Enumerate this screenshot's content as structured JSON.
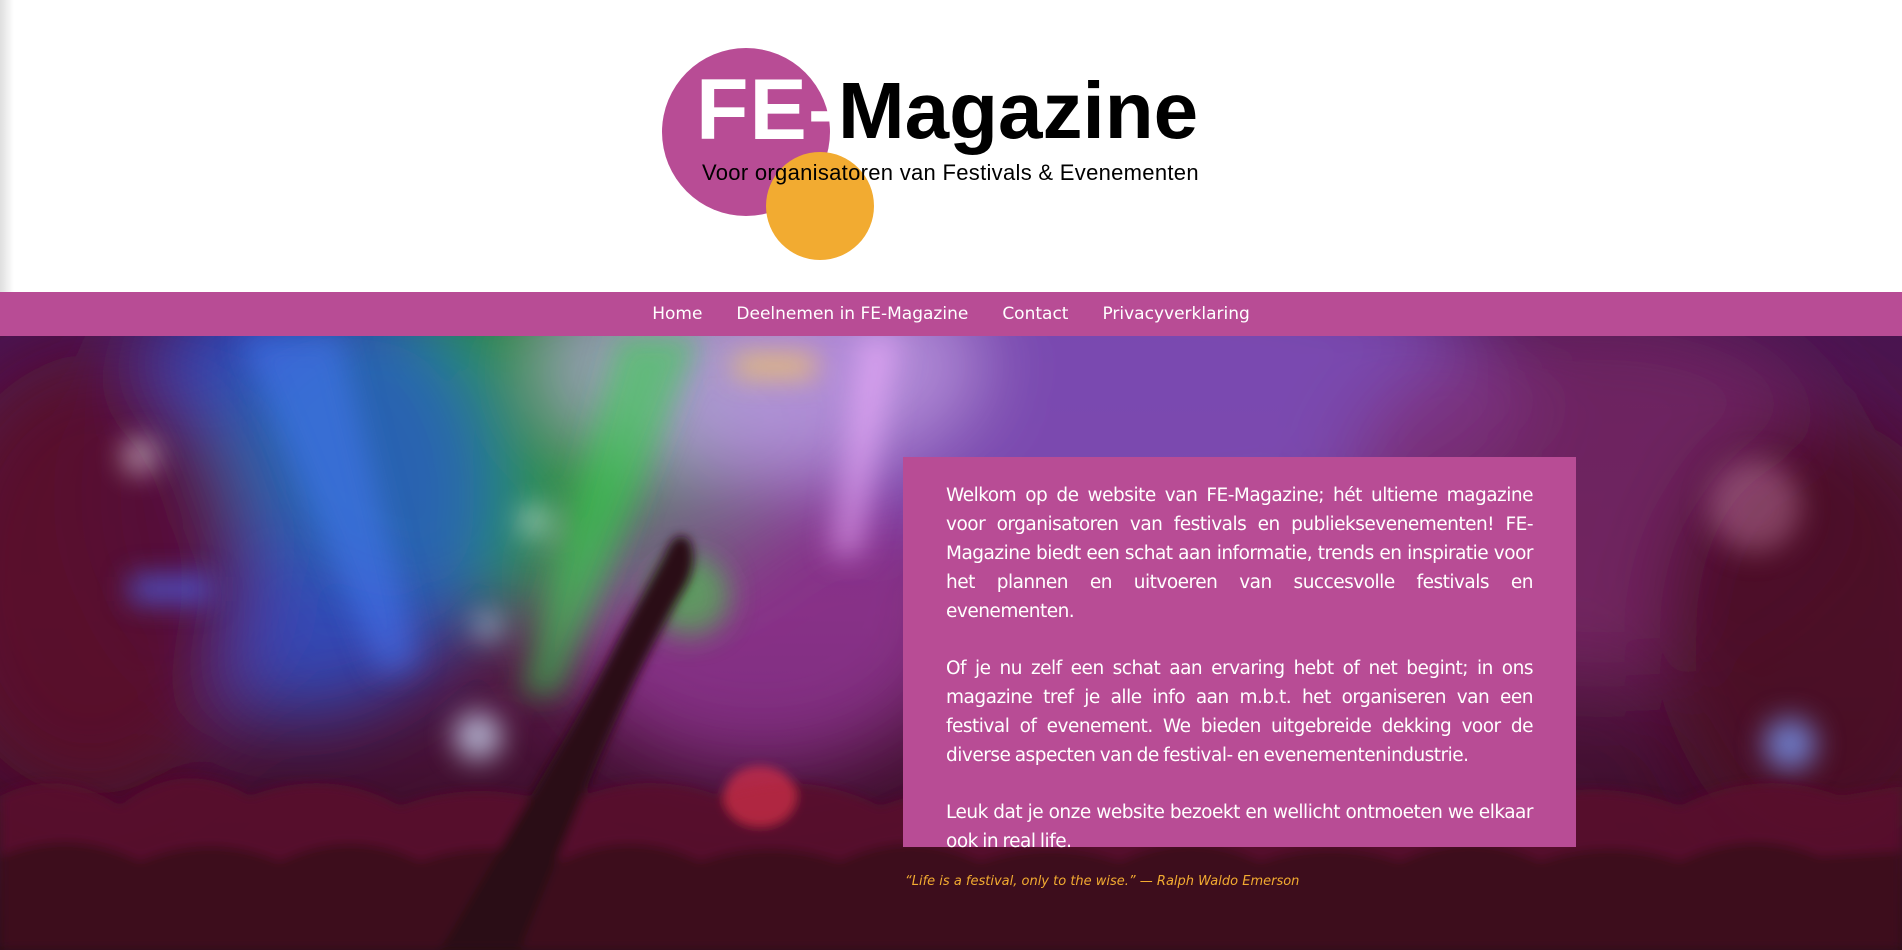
{
  "brand": {
    "logo_prefix": "FE-",
    "logo_name": "Magazine",
    "tagline": "Voor organisatoren van Festivals & Evenementen",
    "colors": {
      "purple": "#b84c95",
      "orange": "#f2ab31",
      "black": "#000000",
      "white": "#ffffff"
    }
  },
  "nav": {
    "items": [
      {
        "label": "Home"
      },
      {
        "label": "Deelnemen in FE-Magazine"
      },
      {
        "label": "Contact"
      },
      {
        "label": "Privacyverklaring"
      }
    ]
  },
  "hero": {
    "background": "festival crowd stage lights photo",
    "intro": [
      "Welkom op de website van FE-Magazine; hét ultieme magazine voor organisatoren van festivals en publieksevenementen! FE-Magazine biedt een schat aan informatie, trends en inspiratie voor het plannen en uitvoeren van succesvolle festivals en evenementen.",
      "Of je nu zelf een schat aan ervaring hebt of net begint; in ons magazine tref je alle info aan m.b.t. het organiseren van een festival of evenement. We bieden uitgebreide dekking voor de diverse aspecten van de festival- en evenementenindustrie.",
      "Leuk dat je onze website bezoekt en wellicht ontmoeten we elkaar ook in real life."
    ],
    "quote": "“Life is a festival, only to the wise.” — Ralph Waldo Emerson"
  }
}
